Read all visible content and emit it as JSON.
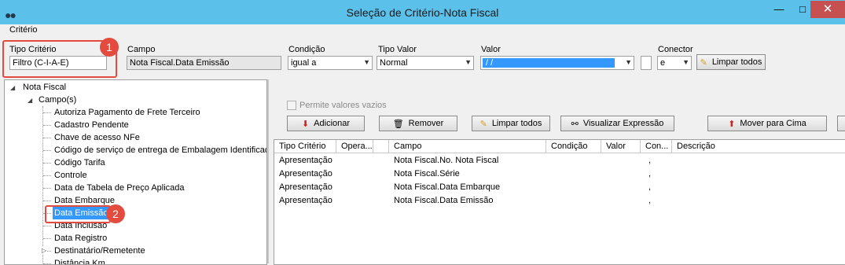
{
  "window": {
    "title": "Seleção de Critério-Nota Fiscal",
    "min": "—",
    "max": "□",
    "close": "✕"
  },
  "menu": {
    "criterio": "Critério"
  },
  "criteria": {
    "tipo_criterio_label": "Tipo Critério",
    "tipo_criterio_value": "Filtro (C-I-A-E)",
    "campo_label": "Campo",
    "campo_value": "Nota Fiscal.Data Emissão",
    "condicao_label": "Condição",
    "condicao_value": "igual a",
    "tipo_valor_label": "Tipo Valor",
    "tipo_valor_value": "Normal",
    "valor_label": "Valor",
    "valor_value": " /  / ",
    "conector_label": "Conector",
    "conector_value": "e",
    "limpar_todos_label": "Limpar todos"
  },
  "markers": {
    "m1": "1",
    "m2": "2"
  },
  "tree": {
    "root": "Nota Fiscal",
    "group": "Campo(s)",
    "items": [
      "Autoriza Pagamento de Frete Terceiro",
      "Cadastro Pendente",
      "Chave de acesso NFe",
      "Código de serviço de entrega de Embalagem Identificada",
      "Código Tarifa",
      "Controle",
      "Data de Tabela de Preço Aplicada",
      "Data Embarque",
      "Data Emissão",
      "Data Inclusão",
      "Data Registro",
      "Destinatário/Remetente",
      "Distância Km"
    ],
    "selected_index": 8
  },
  "actions": {
    "permite_vazios": "Permite valores vazios",
    "adicionar": "Adicionar",
    "remover": "Remover",
    "limpar_todos": "Limpar todos",
    "visualizar": "Visualizar Expressão",
    "mover_cima": "Mover para Cima"
  },
  "grid": {
    "columns": [
      "Tipo Critério",
      "Opera...",
      "",
      "Campo",
      "Condição",
      "Valor",
      "Con...",
      "Descrição"
    ],
    "rows": [
      [
        "Apresentação",
        "",
        "",
        "Nota Fiscal.No. Nota Fiscal",
        "",
        "",
        ",",
        ""
      ],
      [
        "Apresentação",
        "",
        "",
        "Nota Fiscal.Série",
        "",
        "",
        ",",
        ""
      ],
      [
        "Apresentação",
        "",
        "",
        "Nota Fiscal.Data Embarque",
        "",
        "",
        ",",
        ""
      ],
      [
        "Apresentação",
        "",
        "",
        "Nota Fiscal.Data Emissão",
        "",
        "",
        ",",
        ""
      ]
    ]
  },
  "colors": {
    "titlebar": "#5bc0ea",
    "marker": "#e24b3d",
    "selection": "#3399ff"
  }
}
